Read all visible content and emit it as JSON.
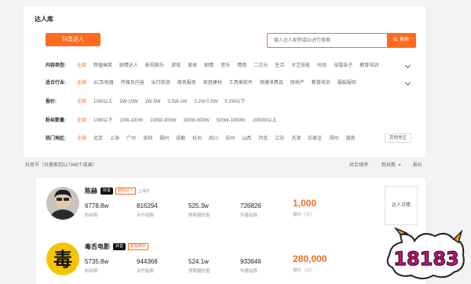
{
  "page_title": "达人库",
  "tab": "抖音达人",
  "search": {
    "placeholder": "输入达人昵称或ID进行搜索",
    "button": "搜索"
  },
  "filters": [
    {
      "label": "内容类型:",
      "options": [
        "全部",
        "颜值搞笑",
        "剧情达人",
        "影视娱乐",
        "游戏",
        "美食",
        "剧情",
        "音乐",
        "情感",
        "二次元",
        "生活",
        "才艺技能",
        "时尚",
        "母婴亲子",
        "教育培训"
      ],
      "selected": 0,
      "expandable": true
    },
    {
      "label": "适合行业:",
      "options": [
        "全部",
        "3C及电器",
        "传媒及内容",
        "出行旅游",
        "商务服务",
        "家居建材",
        "工具类软件",
        "快捷消费品",
        "房地产",
        "教育培训",
        "服装服饰"
      ],
      "selected": 0,
      "expandable": true
    },
    {
      "label": "报价:",
      "options": [
        "全部",
        "10W以上",
        "5W-10W",
        "1W-5W",
        "0.5W-1W",
        "0.2W-0.5W",
        "0.2W以下"
      ],
      "selected": 0
    },
    {
      "label": "粉丝数量:",
      "options": [
        "全部",
        "10W以下",
        "10W-100W",
        "100W-300W",
        "300W-500W",
        "500W-1000W",
        "1000W以上"
      ],
      "selected": 0
    },
    {
      "label": "热门地区:",
      "options": [
        "全部",
        "北京",
        "上海",
        "广州",
        "深圳",
        "福州",
        "成都",
        "杭州",
        "四川",
        "苏州",
        "山西",
        "河北",
        "江苏",
        "天津",
        "石家庄",
        "郑州",
        "湖南"
      ],
      "selected": 0,
      "more_button": "其他地区"
    }
  ],
  "results": {
    "text": "抖音号（共搜索到117948个结果）"
  },
  "sort_options": [
    "综合排序",
    "粉丝数",
    "报价"
  ],
  "talents": [
    {
      "name": "陈赫",
      "platform": "抖音",
      "tag": "剧情达人",
      "location": "上海市",
      "stats": [
        {
          "value": "6778.8w",
          "label": "粉丝数"
        },
        {
          "value": "816294",
          "label": "合作指数"
        },
        {
          "value": "525.3w",
          "label": "预期播放量"
        },
        {
          "value": "726826",
          "label": "传播指数"
        }
      ],
      "price": {
        "value": "1,000",
        "label": "报价（元）"
      },
      "detail_button": "达人详情"
    },
    {
      "name": "毒舌电影",
      "platform": "抖音",
      "tag": "影视娱乐",
      "avatar_text": "毒",
      "stats": [
        {
          "value": "5735.8w",
          "label": "粉丝数"
        },
        {
          "value": "944368",
          "label": "合作指数"
        },
        {
          "value": "524.1w",
          "label": "预期播放量"
        },
        {
          "value": "933646",
          "label": "传播指数"
        }
      ],
      "price": {
        "value": "280,000",
        "label": "报价（元）"
      }
    }
  ],
  "watermark": "18183",
  "colors": {
    "accent": "#ff6a1f",
    "background": "#f2f3f5",
    "card": "#ffffff"
  }
}
